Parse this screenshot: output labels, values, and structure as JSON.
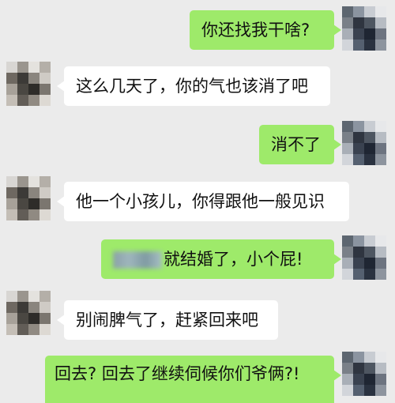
{
  "colors": {
    "background": "#ebebeb",
    "sent_bubble": "#9eea6a",
    "received_bubble": "#ffffff"
  },
  "messages": [
    {
      "side": "me",
      "text": "你还找我干啥?"
    },
    {
      "side": "other",
      "text": "这么几天了，你的气也该消了吧"
    },
    {
      "side": "me",
      "text": "消不了"
    },
    {
      "side": "other",
      "text": "他一个小孩儿，你得跟他一般见识"
    },
    {
      "side": "me",
      "text": "就结婚了，小个屁!",
      "redacted_prefix": true
    },
    {
      "side": "other",
      "text": "别闹脾气了，赶紧回来吧"
    },
    {
      "side": "me",
      "text": "回去? 回去了继续伺候你们爷俩?!"
    }
  ]
}
